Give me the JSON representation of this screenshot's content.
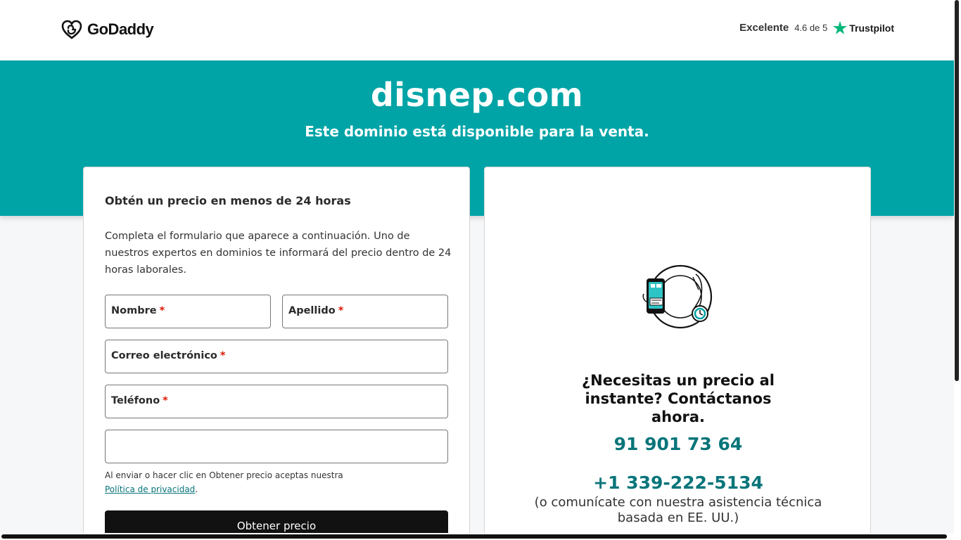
{
  "header": {
    "logo_text": "GoDaddy",
    "trust_label": "Excelente",
    "trust_rating": "4.6 de 5",
    "trust_brand": "Trustpilot"
  },
  "hero": {
    "domain": "disnep.com",
    "subtitle": "Este dominio está disponible para la venta."
  },
  "form": {
    "title": "Obtén un precio en menos de 24 horas",
    "description": "Completa el formulario que aparece a continuación. Uno de nuestros expertos en dominios te informará del precio dentro de 24 horas laborales.",
    "fields": {
      "nombre": "Nombre",
      "apellido": "Apellido",
      "correo": "Correo electrónico",
      "telefono": "Teléfono",
      "required_mark": "*"
    },
    "consent_text": "Al enviar o hacer clic en Obtener precio aceptas nuestra",
    "privacy_link": "Política de privacidad",
    "consent_end": ".",
    "submit_label": "Obtener precio"
  },
  "contact": {
    "heading": "¿Necesitas un precio al instante? Contáctanos ahora.",
    "phone_es": "91 901 73 64",
    "phone_us": "+1 339-222-5134",
    "support_note": "(o comunícate con nuestra asistencia técnica basada en EE. UU.)"
  },
  "colors": {
    "teal": "#00a4a6",
    "link": "#09757a",
    "required": "#db1802",
    "trustpilot_star": "#00b67a"
  }
}
